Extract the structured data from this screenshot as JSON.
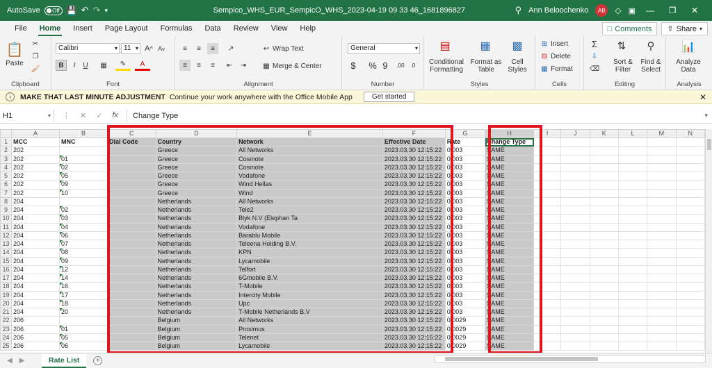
{
  "titlebar": {
    "autosave_label": "AutoSave",
    "autosave_state": "Off",
    "filename": "Sempico_WHS_EUR_SempicO_WHS_2023-04-19 09 33 46_1681896827",
    "user_name": "Ann Beloochenko",
    "user_initials": "AB"
  },
  "menu": {
    "tabs": [
      "File",
      "Home",
      "Insert",
      "Page Layout",
      "Formulas",
      "Data",
      "Review",
      "View",
      "Help"
    ],
    "active_tab": "Home",
    "comments_label": "Comments",
    "share_label": "Share"
  },
  "ribbon": {
    "clipboard": {
      "paste": "Paste",
      "label": "Clipboard"
    },
    "font": {
      "name": "Calibri",
      "size": "11",
      "label": "Font"
    },
    "alignment": {
      "wrap_text": "Wrap Text",
      "merge_center": "Merge & Center",
      "label": "Alignment"
    },
    "number": {
      "format": "General",
      "label": "Number"
    },
    "styles": {
      "conditional": "Conditional",
      "formatting": "Formatting",
      "format_as": "Format as",
      "table": "Table",
      "cell": "Cell",
      "cell_styles": "Styles",
      "label": "Styles"
    },
    "cells": {
      "insert": "Insert",
      "delete": "Delete",
      "format": "Format",
      "label": "Cells"
    },
    "editing": {
      "sort": "Sort &",
      "filter": "Filter",
      "find": "Find &",
      "select": "Select",
      "label": "Editing"
    },
    "analysis": {
      "analyze": "Analyze",
      "data": "Data",
      "label": "Analysis"
    }
  },
  "message_bar": {
    "title": "MAKE THAT LAST MINUTE ADJUSTMENT",
    "text": "Continue your work anywhere with the Office Mobile App",
    "button": "Get started"
  },
  "formula_bar": {
    "name_box": "H1",
    "fx": "fx",
    "value": "Change Type"
  },
  "columns": [
    "A",
    "B",
    "C",
    "D",
    "E",
    "F",
    "G",
    "H",
    "I",
    "J",
    "K",
    "L",
    "M",
    "N"
  ],
  "header_row": [
    "MCC",
    "MNC",
    "Dial Code",
    "Country",
    "Network",
    "Effective Date",
    "Rate",
    "Change Type"
  ],
  "rows": [
    {
      "mcc": "202",
      "mnc": "",
      "country": "Greece",
      "network": "All Networks",
      "date": "2023.03.30 12:15:22",
      "rate": "0.003",
      "change": "SAME"
    },
    {
      "mcc": "202",
      "mnc": "01",
      "country": "Greece",
      "network": "Cosmote",
      "date": "2023.03.30 12:15:22",
      "rate": "0.003",
      "change": "SAME"
    },
    {
      "mcc": "202",
      "mnc": "02",
      "country": "Greece",
      "network": "Cosmote",
      "date": "2023.03.30 12:15:22",
      "rate": "0.003",
      "change": "SAME"
    },
    {
      "mcc": "202",
      "mnc": "05",
      "country": "Greece",
      "network": "Vodafone",
      "date": "2023.03.30 12:15:22",
      "rate": "0.003",
      "change": "SAME"
    },
    {
      "mcc": "202",
      "mnc": "09",
      "country": "Greece",
      "network": "Wind Hellas",
      "date": "2023.03.30 12:15:22",
      "rate": "0.003",
      "change": "SAME"
    },
    {
      "mcc": "202",
      "mnc": "10",
      "country": "Greece",
      "network": "Wind",
      "date": "2023.03.30 12:15:22",
      "rate": "0.003",
      "change": "SAME"
    },
    {
      "mcc": "204",
      "mnc": "",
      "country": "Netherlands",
      "network": "All Networks",
      "date": "2023.03.30 12:15:22",
      "rate": "0.003",
      "change": "SAME"
    },
    {
      "mcc": "204",
      "mnc": "02",
      "country": "Netherlands",
      "network": "Tele2",
      "date": "2023.03.30 12:15:22",
      "rate": "0.003",
      "change": "SAME"
    },
    {
      "mcc": "204",
      "mnc": "03",
      "country": "Netherlands",
      "network": "Blyk N.V (Elephan Ta",
      "date": "2023.03.30 12:15:22",
      "rate": "0.003",
      "change": "SAME"
    },
    {
      "mcc": "204",
      "mnc": "04",
      "country": "Netherlands",
      "network": "Vodafone",
      "date": "2023.03.30 12:15:22",
      "rate": "0.003",
      "change": "SAME"
    },
    {
      "mcc": "204",
      "mnc": "06",
      "country": "Netherlands",
      "network": "Barablu Mobile",
      "date": "2023.03.30 12:15:22",
      "rate": "0.003",
      "change": "SAME"
    },
    {
      "mcc": "204",
      "mnc": "07",
      "country": "Netherlands",
      "network": "Teleena Holding B.V.",
      "date": "2023.03.30 12:15:22",
      "rate": "0.003",
      "change": "SAME"
    },
    {
      "mcc": "204",
      "mnc": "08",
      "country": "Netherlands",
      "network": "KPN",
      "date": "2023.03.30 12:15:22",
      "rate": "0.003",
      "change": "SAME"
    },
    {
      "mcc": "204",
      "mnc": "09",
      "country": "Netherlands",
      "network": "Lycamobile",
      "date": "2023.03.30 12:15:22",
      "rate": "0.003",
      "change": "SAME"
    },
    {
      "mcc": "204",
      "mnc": "12",
      "country": "Netherlands",
      "network": "Telfort",
      "date": "2023.03.30 12:15:22",
      "rate": "0.003",
      "change": "SAME"
    },
    {
      "mcc": "204",
      "mnc": "14",
      "country": "Netherlands",
      "network": "6Gmobile B.V.",
      "date": "2023.03.30 12:15:22",
      "rate": "0.003",
      "change": "SAME"
    },
    {
      "mcc": "204",
      "mnc": "16",
      "country": "Netherlands",
      "network": "T-Mobile",
      "date": "2023.03.30 12:15:22",
      "rate": "0.003",
      "change": "SAME"
    },
    {
      "mcc": "204",
      "mnc": "17",
      "country": "Netherlands",
      "network": "Intercity Mobile",
      "date": "2023.03.30 12:15:22",
      "rate": "0.003",
      "change": "SAME"
    },
    {
      "mcc": "204",
      "mnc": "18",
      "country": "Netherlands",
      "network": "Upc",
      "date": "2023.03.30 12:15:22",
      "rate": "0.003",
      "change": "SAME"
    },
    {
      "mcc": "204",
      "mnc": "20",
      "country": "Netherlands",
      "network": "T-Mobile Netherlands B.V",
      "date": "2023.03.30 12:15:22",
      "rate": "0.003",
      "change": "SAME"
    },
    {
      "mcc": "206",
      "mnc": "",
      "country": "Belgium",
      "network": "All Networks",
      "date": "2023.03.30 12:15:22",
      "rate": "0.0029",
      "change": "SAME"
    },
    {
      "mcc": "206",
      "mnc": "01",
      "country": "Belgium",
      "network": "Proximus",
      "date": "2023.03.30 12:15:22",
      "rate": "0.0029",
      "change": "SAME"
    },
    {
      "mcc": "206",
      "mnc": "05",
      "country": "Belgium",
      "network": "Telenet",
      "date": "2023.03.30 12:15:22",
      "rate": "0.0029",
      "change": "SAME"
    },
    {
      "mcc": "206",
      "mnc": "06",
      "country": "Belgium",
      "network": "Lycamobile",
      "date": "2023.03.30 12:15:22",
      "rate": "0.0029",
      "change": "SAME"
    }
  ],
  "sheet_tab": "Rate List",
  "colors": {
    "excel_green": "#217346",
    "highlight_red": "#e0151e",
    "shaded_cell": "#c9c9c9"
  }
}
